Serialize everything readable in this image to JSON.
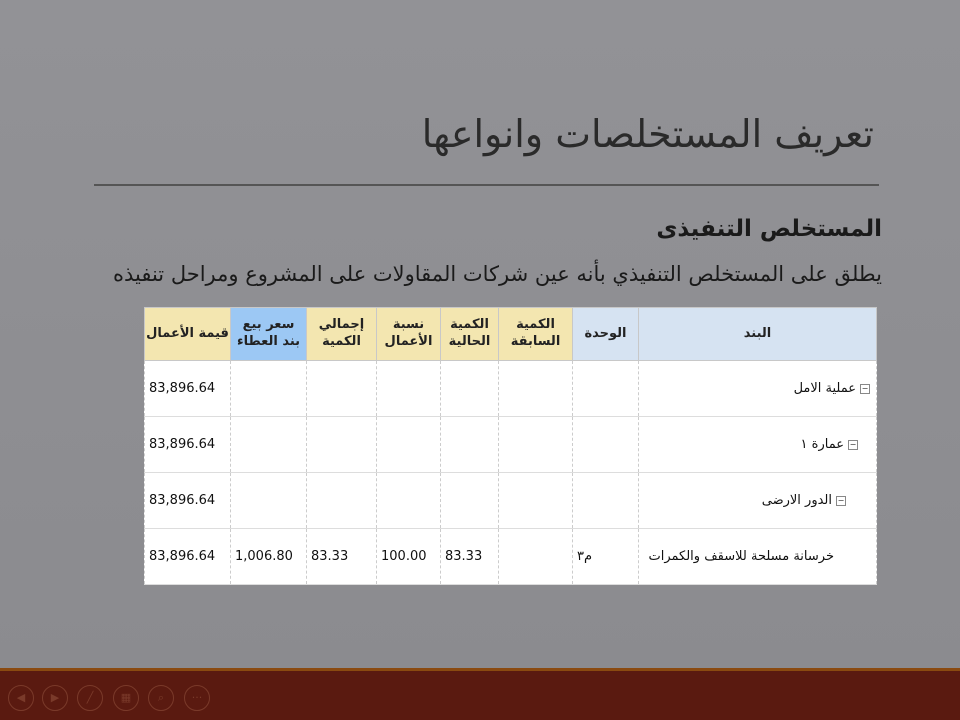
{
  "slide": {
    "title": "تعريف المستخلصات وانواعها",
    "subtitle": "المستخلص التنفيذى",
    "body": "يطلق على المستخلص التنفيذي بأنه عين شركات المقاولات على المشروع ومراحل تنفيذه"
  },
  "table": {
    "headers": [
      "البند",
      "الوحدة",
      "الكمية السابقة",
      "الكمية الحالية",
      "نسبة الأعمال",
      "إجمالي الكمية",
      "سعر بيع بند العطاء",
      "قيمة الأعمال"
    ],
    "rows": [
      {
        "item": "عملية الامل",
        "unit": "",
        "prev": "",
        "curr": "",
        "pct": "",
        "total": "",
        "price": "",
        "value": "83,896.64"
      },
      {
        "item": "عمارة ١",
        "unit": "",
        "prev": "",
        "curr": "",
        "pct": "",
        "total": "",
        "price": "",
        "value": "83,896.64"
      },
      {
        "item": "الدور الارضى",
        "unit": "",
        "prev": "",
        "curr": "",
        "pct": "",
        "total": "",
        "price": "",
        "value": "83,896.64"
      },
      {
        "item": "خرسانة مسلحة للاسقف والكمرات",
        "unit": "م٣",
        "prev": "",
        "curr": "83.33",
        "pct": "100.00",
        "total": "83.33",
        "price": "1,006.80",
        "value": "83,896.64"
      }
    ]
  },
  "controls": [
    "previous-icon",
    "next-icon",
    "pen-icon",
    "slides-icon",
    "zoom-icon",
    "more-icon"
  ]
}
